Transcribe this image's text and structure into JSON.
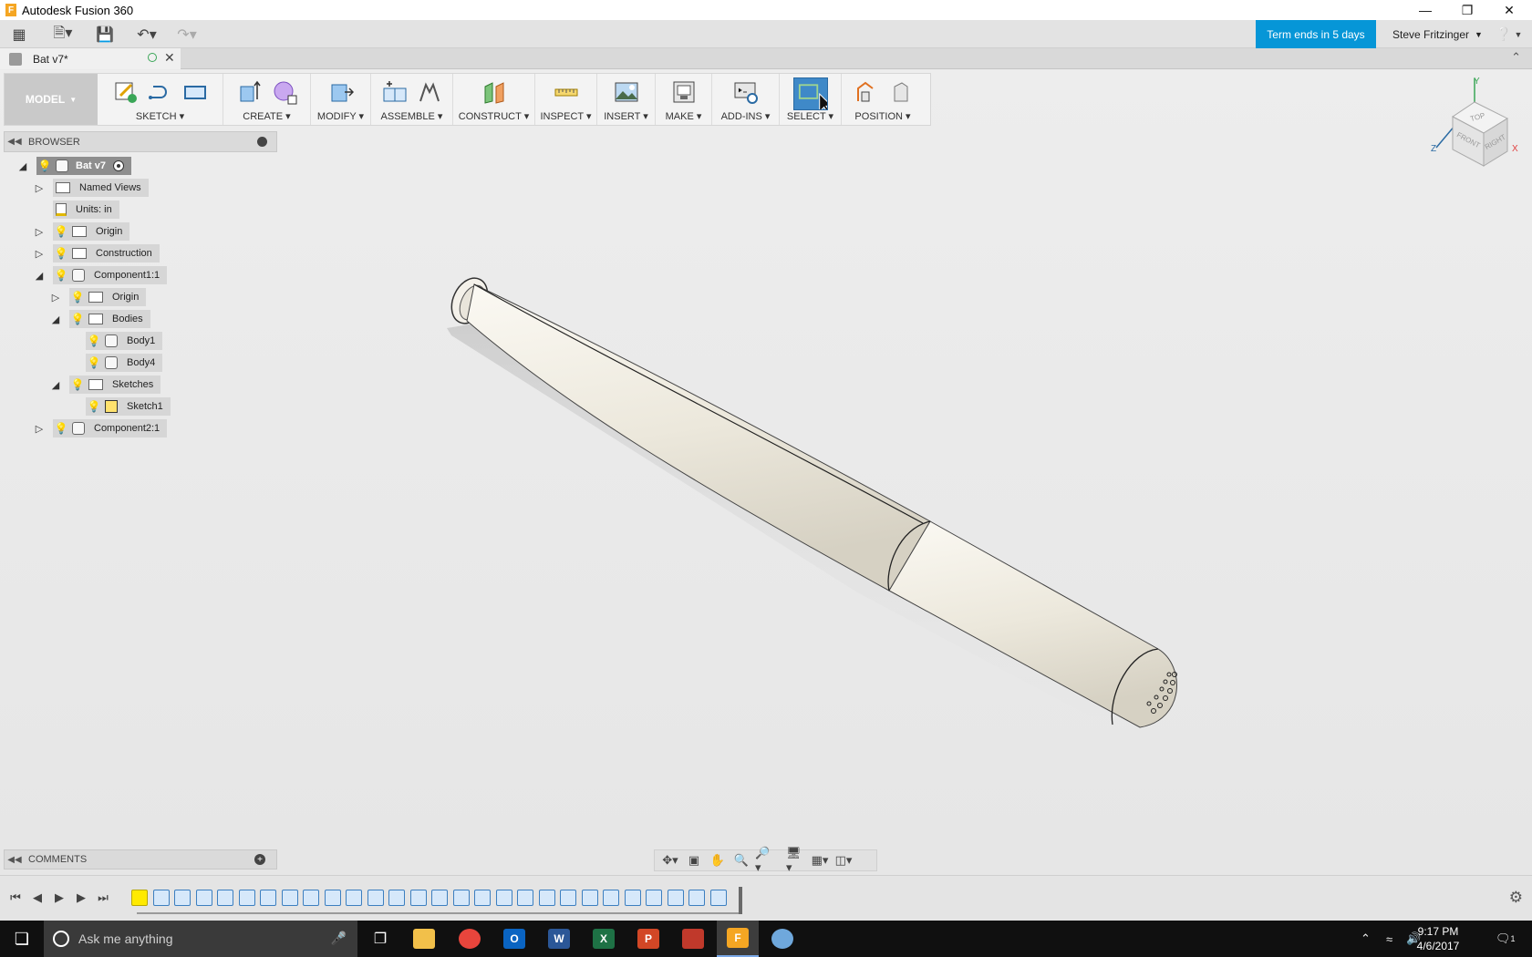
{
  "window": {
    "title": "Autodesk Fusion 360",
    "app_icon": "F"
  },
  "quickbar": {
    "term_label": "Term ends in 5 days",
    "user_name": "Steve Fritzinger"
  },
  "document_tab": {
    "label": "Bat v7*"
  },
  "toolbar": {
    "model_label": "MODEL",
    "groups": [
      {
        "label": "SKETCH"
      },
      {
        "label": "CREATE"
      },
      {
        "label": "MODIFY"
      },
      {
        "label": "ASSEMBLE"
      },
      {
        "label": "CONSTRUCT"
      },
      {
        "label": "INSPECT"
      },
      {
        "label": "INSERT"
      },
      {
        "label": "MAKE"
      },
      {
        "label": "ADD-INS"
      },
      {
        "label": "SELECT"
      },
      {
        "label": "POSITION"
      }
    ]
  },
  "browser": {
    "label": "BROWSER",
    "tree": [
      {
        "label": "Bat v7"
      },
      {
        "label": "Named Views"
      },
      {
        "label": "Units: in"
      },
      {
        "label": "Origin"
      },
      {
        "label": "Construction"
      },
      {
        "label": "Component1:1"
      },
      {
        "label": "Origin"
      },
      {
        "label": "Bodies"
      },
      {
        "label": "Body1"
      },
      {
        "label": "Body4"
      },
      {
        "label": "Sketches"
      },
      {
        "label": "Sketch1"
      },
      {
        "label": "Component2:1"
      }
    ]
  },
  "comments": {
    "label": "COMMENTS"
  },
  "viewcube": {
    "top": "TOP",
    "front": "FRONT",
    "right": "RIGHT",
    "axis_x": "X",
    "axis_y": "Y",
    "axis_z": "Z"
  },
  "taskbar": {
    "search_placeholder": "Ask me anything",
    "time": "9:17 PM",
    "date": "4/6/2017",
    "notification_count": "1",
    "apps": [
      {
        "name": "file-explorer",
        "color": "#f2c04a"
      },
      {
        "name": "chrome",
        "color": "#e8453c"
      },
      {
        "name": "outlook",
        "color": "#0a64c2"
      },
      {
        "name": "word",
        "color": "#2b5797"
      },
      {
        "name": "excel",
        "color": "#1e7145"
      },
      {
        "name": "powerpoint",
        "color": "#d24726"
      },
      {
        "name": "autodesk",
        "color": "#c0392b"
      },
      {
        "name": "fusion-360",
        "color": "#f5a623"
      },
      {
        "name": "paint",
        "color": "#6fa8dc"
      }
    ],
    "app_letters": {
      "outlook": "O",
      "word": "W",
      "excel": "X",
      "powerpoint": "P",
      "fusion": "F"
    }
  },
  "colors": {
    "accent": "#0696d7",
    "bat": "#eeeadf",
    "bulb_on": "#e8b800",
    "bulb_off": "#7fb2e6"
  }
}
